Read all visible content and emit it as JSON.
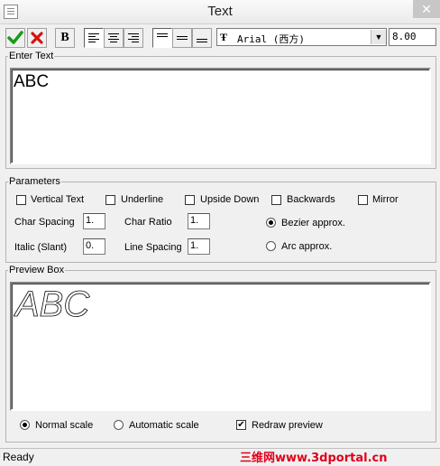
{
  "window": {
    "title": "Text"
  },
  "toolbar": {
    "bold_label": "B",
    "font_name": "Arial (西方)",
    "font_size": "8.00"
  },
  "enter_text": {
    "legend": "Enter Text",
    "value": "ABC"
  },
  "parameters": {
    "legend": "Parameters",
    "vertical_text": "Vertical Text",
    "underline": "Underline",
    "upside_down": "Upside Down",
    "backwards": "Backwards",
    "mirror": "Mirror",
    "char_spacing_label": "Char Spacing",
    "char_spacing_value": "1.",
    "char_ratio_label": "Char Ratio",
    "char_ratio_value": "1.",
    "italic_label": "Italic (Slant)",
    "italic_value": "0.",
    "line_spacing_label": "Line Spacing",
    "line_spacing_value": "1.",
    "bezier_label": "Bezier approx.",
    "arc_label": "Arc approx."
  },
  "preview": {
    "legend": "Preview Box",
    "sample": "ABC",
    "normal_scale": "Normal scale",
    "automatic_scale": "Automatic scale",
    "redraw_preview": "Redraw preview"
  },
  "status": {
    "text": "Ready"
  },
  "watermark": "三维网www.3dportal.cn",
  "colors": {
    "ok_green": "#1a9a1a",
    "cancel_red": "#d41414",
    "window_bg": "#f0f0f0"
  }
}
